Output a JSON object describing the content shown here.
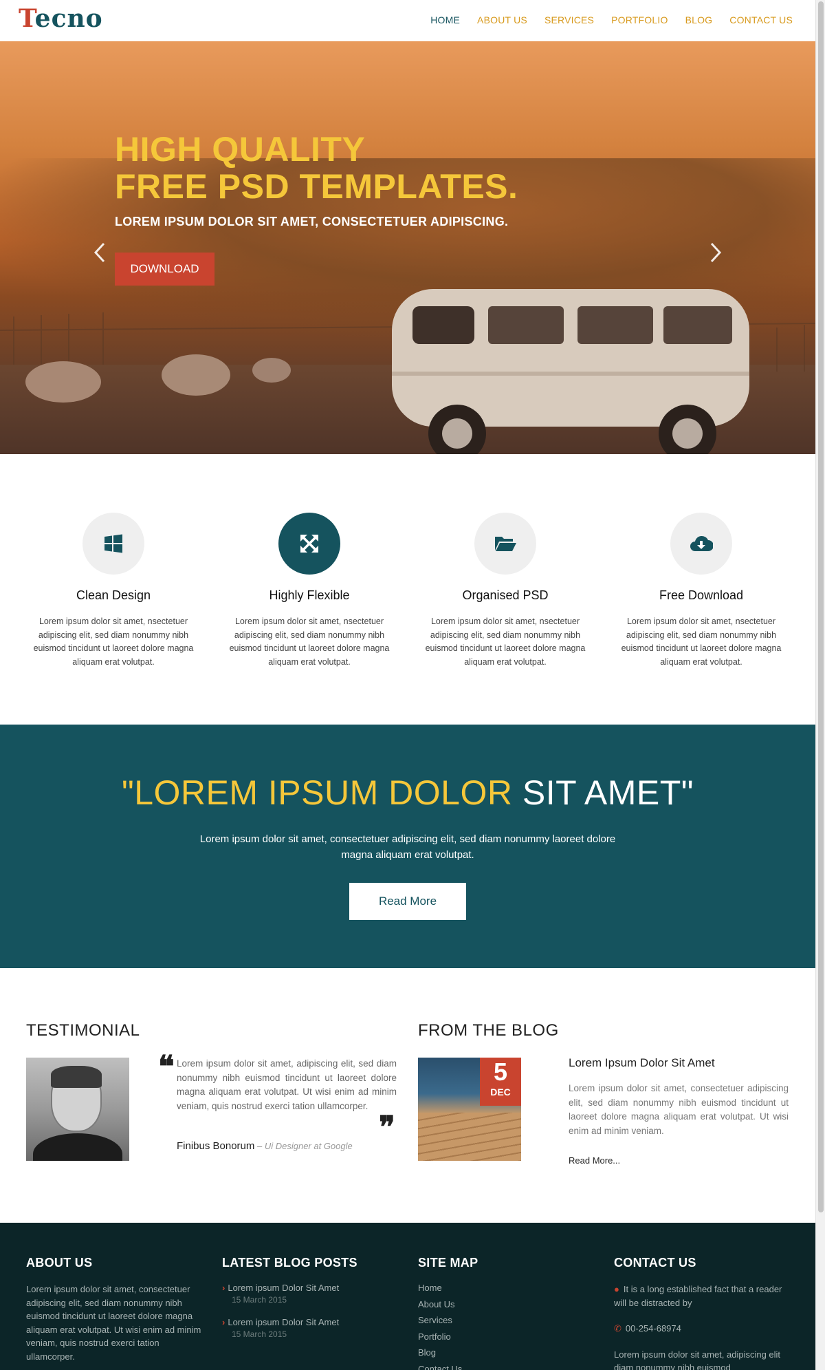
{
  "header": {
    "logo_t": "T",
    "logo_rest": "ecno",
    "nav": [
      {
        "label": "HOME",
        "active": true
      },
      {
        "label": "ABOUT US",
        "active": false
      },
      {
        "label": "SERVICES",
        "active": false
      },
      {
        "label": "PORTFOLIO",
        "active": false
      },
      {
        "label": "BLOG",
        "active": false
      },
      {
        "label": "CONTACT US",
        "active": false
      }
    ]
  },
  "hero": {
    "title_line1": "HIGH QUALITY",
    "title_line2": "FREE PSD TEMPLATES.",
    "subtitle": "LOREM IPSUM DOLOR SIT AMET, CONSECTETUER ADIPISCING.",
    "button": "DOWNLOAD",
    "prev_icon": "chevron-left-icon",
    "next_icon": "chevron-right-icon"
  },
  "features": [
    {
      "title": "Clean Design",
      "icon": "windows-icon",
      "text": "Lorem ipsum dolor sit amet, nsectetuer adipiscing elit, sed diam nonummy nibh euismod tincidunt ut laoreet dolore magna aliquam erat volutpat."
    },
    {
      "title": "Highly Flexible",
      "icon": "expand-arrows-icon",
      "text": "Lorem ipsum dolor sit amet, nsectetuer adipiscing elit, sed diam nonummy nibh euismod tincidunt ut laoreet dolore magna aliquam erat volutpat."
    },
    {
      "title": "Organised PSD",
      "icon": "folder-open-icon",
      "text": "Lorem ipsum dolor sit amet, nsectetuer adipiscing elit, sed diam nonummy nibh euismod tincidunt ut laoreet dolore magna aliquam erat volutpat."
    },
    {
      "title": "Free Download",
      "icon": "cloud-download-icon",
      "text": "Lorem ipsum dolor sit amet, nsectetuer adipiscing elit, sed diam nonummy nibh euismod tincidunt ut laoreet dolore magna aliquam erat volutpat."
    }
  ],
  "band": {
    "quote_yellow": "\"LOREM IPSUM DOLOR",
    "quote_white": " SIT AMET\"",
    "text": "Lorem ipsum dolor sit amet, consectetuer adipiscing elit, sed diam nonummy laoreet dolore magna aliquam erat volutpat.",
    "button": "Read More"
  },
  "testimonial": {
    "heading": "TESTIMONIAL",
    "text": "Lorem ipsum dolor sit amet, adipiscing elit, sed diam nonummy nibh euismod tincidunt ut laoreet dolore magna aliquam erat volutpat. Ut wisi enim ad minim veniam, quis nostrud exerci tation ullamcorper.",
    "name": "Finibus Bonorum",
    "role": " – Ui Designer at Google"
  },
  "blog": {
    "heading": "FROM THE BLOG",
    "day": "5",
    "month": "DEC",
    "title": "Lorem Ipsum Dolor Sit Amet",
    "text": "Lorem ipsum dolor sit amet, consectetuer adipiscing elit, sed diam nonummy nibh euismod tincidunt ut laoreet dolore magna aliquam erat volutpat. Ut wisi enim ad minim veniam.",
    "more": "Read More..."
  },
  "footer": {
    "about_heading": "ABOUT US",
    "about_text": "Lorem ipsum dolor sit amet, consectetuer adipiscing elit, sed diam nonummy nibh euismod tincidunt ut laoreet dolore magna aliquam erat volutpat. Ut wisi enim ad minim veniam, quis nostrud exerci tation ullamcorper.",
    "posts_heading": "LATEST BLOG POSTS",
    "posts": [
      {
        "title": "Lorem ipsum Dolor Sit Amet",
        "date": "15 March 2015"
      },
      {
        "title": "Lorem ipsum Dolor Sit Amet",
        "date": "15 March 2015"
      }
    ],
    "sitemap_heading": "SITE MAP",
    "sitemap": [
      "Home",
      "About Us",
      "Services",
      "Portfolio",
      "Blog",
      "Contact Us"
    ],
    "contact_heading": "CONTACT US",
    "address": "It is a long established fact that a reader will be distracted by",
    "phone": "00-254-68974",
    "contact_text": "Lorem ipsum dolor sit amet, adipiscing elit diam nonummy nibh euismod"
  },
  "colors": {
    "brand_teal": "#15535e",
    "accent_red": "#c9442f",
    "accent_yellow": "#f5c73a",
    "nav_orange": "#d89a1d",
    "footer_bg": "#0c2528"
  }
}
